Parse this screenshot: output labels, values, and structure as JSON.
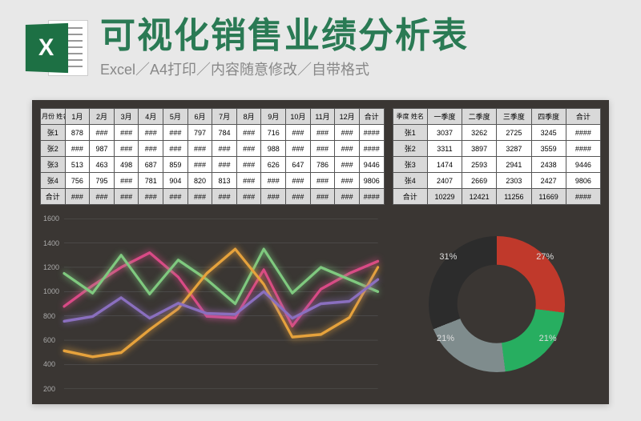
{
  "header": {
    "icon_letter": "X",
    "title": "可视化销售业绩分析表",
    "subtitle": "Excel／A4打印／内容随意修改／自带格式"
  },
  "monthly_table": {
    "corner": "月份\n姓名",
    "columns": [
      "1月",
      "2月",
      "3月",
      "4月",
      "5月",
      "6月",
      "7月",
      "8月",
      "9月",
      "10月",
      "11月",
      "12月",
      "合计"
    ],
    "rows": [
      {
        "name": "张1",
        "cells": [
          "878",
          "###",
          "###",
          "###",
          "###",
          "797",
          "784",
          "###",
          "716",
          "###",
          "###",
          "###",
          "####"
        ]
      },
      {
        "name": "张2",
        "cells": [
          "###",
          "987",
          "###",
          "###",
          "###",
          "###",
          "###",
          "###",
          "988",
          "###",
          "###",
          "###",
          "####"
        ]
      },
      {
        "name": "张3",
        "cells": [
          "513",
          "463",
          "498",
          "687",
          "859",
          "###",
          "###",
          "###",
          "626",
          "647",
          "786",
          "###",
          "9446"
        ]
      },
      {
        "name": "张4",
        "cells": [
          "756",
          "795",
          "###",
          "781",
          "904",
          "820",
          "813",
          "###",
          "###",
          "###",
          "###",
          "###",
          "9806"
        ]
      }
    ],
    "total": {
      "name": "合计",
      "cells": [
        "###",
        "###",
        "###",
        "###",
        "###",
        "###",
        "###",
        "###",
        "###",
        "###",
        "###",
        "###",
        "####"
      ]
    }
  },
  "quarter_table": {
    "corner": "季度\n姓名",
    "columns": [
      "一季度",
      "二季度",
      "三季度",
      "四季度",
      "合计"
    ],
    "rows": [
      {
        "name": "张1",
        "cells": [
          "3037",
          "3262",
          "2725",
          "3245",
          "####"
        ]
      },
      {
        "name": "张2",
        "cells": [
          "3311",
          "3897",
          "3287",
          "3559",
          "####"
        ]
      },
      {
        "name": "张3",
        "cells": [
          "1474",
          "2593",
          "2941",
          "2438",
          "9446"
        ]
      },
      {
        "name": "张4",
        "cells": [
          "2407",
          "2669",
          "2303",
          "2427",
          "9806"
        ]
      }
    ],
    "total": {
      "name": "合计",
      "cells": [
        "10229",
        "12421",
        "11256",
        "11669",
        "####"
      ]
    }
  },
  "chart_data": [
    {
      "type": "line",
      "title": "",
      "xlabel": "",
      "ylabel": "",
      "ylim": [
        200,
        1600
      ],
      "y_ticks": [
        200,
        400,
        600,
        800,
        1000,
        1200,
        1400,
        1600
      ],
      "x": [
        1,
        2,
        3,
        4,
        5,
        6,
        7,
        8,
        9,
        10,
        11,
        12
      ],
      "series": [
        {
          "name": "张1",
          "color": "#d94a86",
          "values": [
            878,
            1050,
            1200,
            1320,
            1120,
            797,
            784,
            1180,
            716,
            1020,
            1150,
            1250
          ]
        },
        {
          "name": "张2",
          "color": "#7fc97f",
          "values": [
            1150,
            987,
            1300,
            980,
            1260,
            1100,
            900,
            1350,
            988,
            1200,
            1100,
            1000
          ]
        },
        {
          "name": "张3",
          "color": "#e6a23c",
          "values": [
            513,
            463,
            498,
            687,
            859,
            1150,
            1350,
            1060,
            626,
            647,
            786,
            1200
          ]
        },
        {
          "name": "张4",
          "color": "#8a6fbf",
          "values": [
            756,
            795,
            950,
            781,
            904,
            820,
            813,
            1000,
            780,
            900,
            920,
            1100
          ]
        }
      ]
    },
    {
      "type": "pie",
      "title": "",
      "slices": [
        {
          "label": "27%",
          "value": 27,
          "color": "#c0392b"
        },
        {
          "label": "21%",
          "value": 21,
          "color": "#27ae60"
        },
        {
          "label": "21%",
          "value": 21,
          "color": "#7f8c8d"
        },
        {
          "label": "31%",
          "value": 31,
          "color": "#2c2c2c"
        }
      ]
    }
  ]
}
